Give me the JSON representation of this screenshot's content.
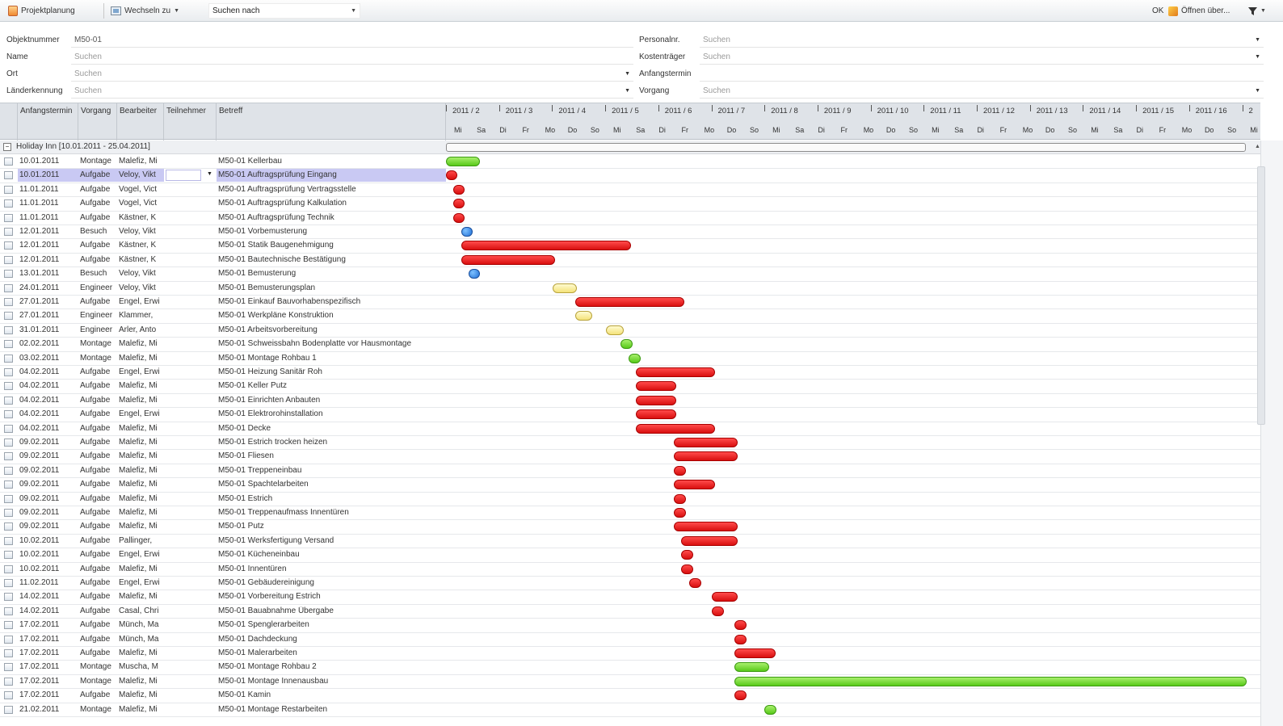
{
  "toolbar": {
    "project_label": "Projektplanung",
    "switch_label": "Wechseln zu",
    "search_placeholder": "Suchen nach",
    "ok_label": "OK",
    "open_label": "Öffnen über..."
  },
  "filters": {
    "objektnummer_label": "Objektnummer",
    "objektnummer_value": "M50-01",
    "name_label": "Name",
    "name_value": "Suchen",
    "ort_label": "Ort",
    "ort_value": "Suchen",
    "laenderkennung_label": "Länderkennung",
    "laenderkennung_value": "Suchen",
    "personalnr_label": "Personalnr.",
    "personalnr_value": "Suchen",
    "kostentraeger_label": "Kostenträger",
    "kostentraeger_value": "Suchen",
    "anfangstermin_label": "Anfangstermin",
    "vorgang_label": "Vorgang",
    "vorgang_value": "Suchen"
  },
  "grid": {
    "columns": [
      "Anfangstermin",
      "Vorgang",
      "Bearbeiter",
      "Teilnehmer",
      "Betreff"
    ],
    "weeks": [
      "2011 / 2",
      "2011 / 3",
      "2011 / 4",
      "2011 / 5",
      "2011 / 6",
      "2011 / 7",
      "2011 / 8",
      "2011 / 9",
      "2011 / 10",
      "2011 / 11",
      "2011 / 12",
      "2011 / 13",
      "2011 / 14",
      "2011 / 15",
      "2011 / 16",
      "2"
    ],
    "days": [
      "Mi",
      "Sa",
      "Di",
      "Fr",
      "Mo",
      "Do",
      "So",
      "Mi",
      "Sa",
      "Di",
      "Fr",
      "Mo",
      "Do",
      "So",
      "Mi",
      "Sa",
      "Di",
      "Fr",
      "Mo",
      "Do",
      "So",
      "Mi",
      "Sa",
      "Di",
      "Fr",
      "Mo",
      "Do",
      "So",
      "Mi",
      "Sa",
      "Di",
      "Fr",
      "Mo",
      "Do",
      "So",
      "Mi"
    ],
    "group_label": "Holiday Inn [10.01.2011 - 25.04.2011]",
    "colors": {
      "red": "#e51b1b",
      "green": "#7fdc3a",
      "yellow": "#f8ed9e",
      "blue": "#2f86e8",
      "selected": "#c9c9f3"
    },
    "rows": [
      {
        "date": "10.01.2011",
        "vorgang": "Montage",
        "bearbeiter": "Malefiz, Mi",
        "betreff": "M50-01 Kellerbau",
        "bar": "green",
        "start": 0,
        "end": 42
      },
      {
        "date": "10.01.2011",
        "vorgang": "Aufgabe",
        "bearbeiter": "Veloy, Vikt",
        "betreff": "M50-01 Auftragsprüfung Eingang",
        "bar": "red",
        "start": 0,
        "end": 14,
        "selected": true
      },
      {
        "date": "11.01.2011",
        "vorgang": "Aufgabe",
        "bearbeiter": "Vogel, Vict",
        "betreff": "M50-01 Auftragsprüfung Vertragsstelle",
        "bar": "red",
        "start": 9,
        "end": 23
      },
      {
        "date": "11.01.2011",
        "vorgang": "Aufgabe",
        "bearbeiter": "Vogel, Vict",
        "betreff": "M50-01 Auftragsprüfung Kalkulation",
        "bar": "red",
        "start": 9,
        "end": 23
      },
      {
        "date": "11.01.2011",
        "vorgang": "Aufgabe",
        "bearbeiter": "Kästner, K",
        "betreff": "M50-01 Auftragsprüfung Technik",
        "bar": "red",
        "start": 9,
        "end": 23
      },
      {
        "date": "12.01.2011",
        "vorgang": "Besuch",
        "bearbeiter": "Veloy, Vikt",
        "betreff": "M50-01 Vorbemusterung",
        "bar": "blue",
        "start": 19,
        "end": 33
      },
      {
        "date": "12.01.2011",
        "vorgang": "Aufgabe",
        "bearbeiter": "Kästner, K",
        "betreff": "M50-01 Statik Baugenehmigung",
        "bar": "red",
        "start": 19,
        "end": 229
      },
      {
        "date": "12.01.2011",
        "vorgang": "Aufgabe",
        "bearbeiter": "Kästner, K",
        "betreff": "M50-01 Bautechnische Bestätigung",
        "bar": "red",
        "start": 19,
        "end": 135
      },
      {
        "date": "13.01.2011",
        "vorgang": "Besuch",
        "bearbeiter": "Veloy, Vikt",
        "betreff": "M50-01 Bemusterung",
        "bar": "blue",
        "start": 28,
        "end": 42
      },
      {
        "date": "24.01.2011",
        "vorgang": "Engineer",
        "bearbeiter": "Veloy, Vikt",
        "betreff": "M50-01 Bemusterungsplan",
        "bar": "yellow",
        "start": 132,
        "end": 162
      },
      {
        "date": "27.01.2011",
        "vorgang": "Aufgabe",
        "bearbeiter": "Engel, Erwi",
        "betreff": "M50-01 Einkauf Bauvorhabenspezifisch",
        "bar": "red",
        "start": 160,
        "end": 295
      },
      {
        "date": "27.01.2011",
        "vorgang": "Engineer",
        "bearbeiter": "Klammer,",
        "betreff": "M50-01 Werkpläne Konstruktion",
        "bar": "yellow",
        "start": 160,
        "end": 181
      },
      {
        "date": "31.01.2011",
        "vorgang": "Engineer",
        "bearbeiter": "Arler, Anto",
        "betreff": "M50-01 Arbeitsvorbereitung",
        "bar": "yellow",
        "start": 198,
        "end": 220
      },
      {
        "date": "02.02.2011",
        "vorgang": "Montage",
        "bearbeiter": "Malefiz, Mi",
        "betreff": "M50-01 Schweissbahn Bodenplatte vor Hausmontage",
        "bar": "green",
        "start": 216,
        "end": 231
      },
      {
        "date": "03.02.2011",
        "vorgang": "Montage",
        "bearbeiter": "Malefiz, Mi",
        "betreff": "M50-01 Montage Rohbau 1",
        "bar": "green",
        "start": 226,
        "end": 241
      },
      {
        "date": "04.02.2011",
        "vorgang": "Aufgabe",
        "bearbeiter": "Engel, Erwi",
        "betreff": "M50-01 Heizung Sanitär Roh",
        "bar": "red",
        "start": 235,
        "end": 333
      },
      {
        "date": "04.02.2011",
        "vorgang": "Aufgabe",
        "bearbeiter": "Malefiz, Mi",
        "betreff": "M50-01 Keller Putz",
        "bar": "red",
        "start": 235,
        "end": 285
      },
      {
        "date": "04.02.2011",
        "vorgang": "Aufgabe",
        "bearbeiter": "Malefiz, Mi",
        "betreff": "M50-01 Einrichten Anbauten",
        "bar": "red",
        "start": 235,
        "end": 285
      },
      {
        "date": "04.02.2011",
        "vorgang": "Aufgabe",
        "bearbeiter": "Engel, Erwi",
        "betreff": "M50-01 Elektrorohinstallation",
        "bar": "red",
        "start": 235,
        "end": 285
      },
      {
        "date": "04.02.2011",
        "vorgang": "Aufgabe",
        "bearbeiter": "Malefiz, Mi",
        "betreff": "M50-01 Decke",
        "bar": "red",
        "start": 235,
        "end": 333
      },
      {
        "date": "09.02.2011",
        "vorgang": "Aufgabe",
        "bearbeiter": "Malefiz, Mi",
        "betreff": "M50-01 Estrich trocken heizen",
        "bar": "red",
        "start": 282,
        "end": 361
      },
      {
        "date": "09.02.2011",
        "vorgang": "Aufgabe",
        "bearbeiter": "Malefiz, Mi",
        "betreff": "M50-01 Fliesen",
        "bar": "red",
        "start": 282,
        "end": 361
      },
      {
        "date": "09.02.2011",
        "vorgang": "Aufgabe",
        "bearbeiter": "Malefiz, Mi",
        "betreff": "M50-01 Treppeneinbau",
        "bar": "red",
        "start": 282,
        "end": 297
      },
      {
        "date": "09.02.2011",
        "vorgang": "Aufgabe",
        "bearbeiter": "Malefiz, Mi",
        "betreff": "M50-01 Spachtelarbeiten",
        "bar": "red",
        "start": 282,
        "end": 333
      },
      {
        "date": "09.02.2011",
        "vorgang": "Aufgabe",
        "bearbeiter": "Malefiz, Mi",
        "betreff": "M50-01 Estrich",
        "bar": "red",
        "start": 282,
        "end": 297
      },
      {
        "date": "09.02.2011",
        "vorgang": "Aufgabe",
        "bearbeiter": "Malefiz, Mi",
        "betreff": "M50-01 Treppenaufmass Innentüren",
        "bar": "red",
        "start": 282,
        "end": 297
      },
      {
        "date": "09.02.2011",
        "vorgang": "Aufgabe",
        "bearbeiter": "Malefiz, Mi",
        "betreff": "M50-01 Putz",
        "bar": "red",
        "start": 282,
        "end": 361
      },
      {
        "date": "10.02.2011",
        "vorgang": "Aufgabe",
        "bearbeiter": "Pallinger,",
        "betreff": "M50-01 Werksfertigung Versand",
        "bar": "red",
        "start": 291,
        "end": 361
      },
      {
        "date": "10.02.2011",
        "vorgang": "Aufgabe",
        "bearbeiter": "Engel, Erwi",
        "betreff": "M50-01 Kücheneinbau",
        "bar": "red",
        "start": 291,
        "end": 306
      },
      {
        "date": "10.02.2011",
        "vorgang": "Aufgabe",
        "bearbeiter": "Malefiz, Mi",
        "betreff": "M50-01 Innentüren",
        "bar": "red",
        "start": 291,
        "end": 306
      },
      {
        "date": "11.02.2011",
        "vorgang": "Aufgabe",
        "bearbeiter": "Engel, Erwi",
        "betreff": "M50-01 Gebäudereinigung",
        "bar": "red",
        "start": 301,
        "end": 316
      },
      {
        "date": "14.02.2011",
        "vorgang": "Aufgabe",
        "bearbeiter": "Malefiz, Mi",
        "betreff": "M50-01 Vorbereitung Estrich",
        "bar": "red",
        "start": 329,
        "end": 361
      },
      {
        "date": "14.02.2011",
        "vorgang": "Aufgabe",
        "bearbeiter": "Casal, Chri",
        "betreff": "M50-01 Bauabnahme Übergabe",
        "bar": "red",
        "start": 329,
        "end": 344
      },
      {
        "date": "17.02.2011",
        "vorgang": "Aufgabe",
        "bearbeiter": "Münch, Ma",
        "betreff": "M50-01 Spenglerarbeiten",
        "bar": "red",
        "start": 357,
        "end": 372
      },
      {
        "date": "17.02.2011",
        "vorgang": "Aufgabe",
        "bearbeiter": "Münch, Ma",
        "betreff": "M50-01 Dachdeckung",
        "bar": "red",
        "start": 357,
        "end": 372
      },
      {
        "date": "17.02.2011",
        "vorgang": "Aufgabe",
        "bearbeiter": "Malefiz, Mi",
        "betreff": "M50-01 Malerarbeiten",
        "bar": "red",
        "start": 357,
        "end": 408
      },
      {
        "date": "17.02.2011",
        "vorgang": "Montage",
        "bearbeiter": "Muscha, M",
        "betreff": "M50-01 Montage Rohbau 2",
        "bar": "green",
        "start": 357,
        "end": 400
      },
      {
        "date": "17.02.2011",
        "vorgang": "Montage",
        "bearbeiter": "Malefiz, Mi",
        "betreff": "M50-01 Montage Innenausbau",
        "bar": "green",
        "start": 357,
        "end": 991
      },
      {
        "date": "17.02.2011",
        "vorgang": "Aufgabe",
        "bearbeiter": "Malefiz, Mi",
        "betreff": "M50-01 Kamin",
        "bar": "red",
        "start": 357,
        "end": 372
      },
      {
        "date": "21.02.2011",
        "vorgang": "Montage",
        "bearbeiter": "Malefiz, Mi",
        "betreff": "M50-01 Montage Restarbeiten",
        "bar": "green",
        "start": 394,
        "end": 409
      }
    ]
  }
}
